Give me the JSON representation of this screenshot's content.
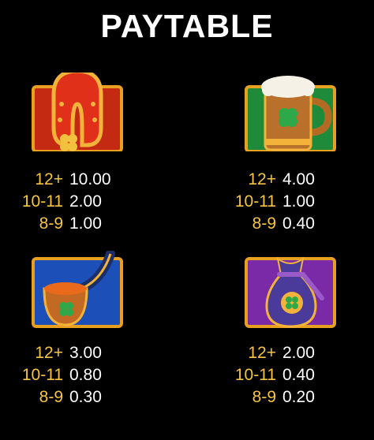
{
  "title": "PAYTABLE",
  "symbols": [
    {
      "icon": "horseshoe-icon",
      "bg": "#c42a12",
      "pays": [
        {
          "count": "12+",
          "value": "10.00"
        },
        {
          "count": "10-11",
          "value": "2.00"
        },
        {
          "count": "8-9",
          "value": "1.00"
        }
      ]
    },
    {
      "icon": "beer-mug-icon",
      "bg": "#1f8a3a",
      "pays": [
        {
          "count": "12+",
          "value": "4.00"
        },
        {
          "count": "10-11",
          "value": "1.00"
        },
        {
          "count": "8-9",
          "value": "0.40"
        }
      ]
    },
    {
      "icon": "pipe-icon",
      "bg": "#1c4fb8",
      "pays": [
        {
          "count": "12+",
          "value": "3.00"
        },
        {
          "count": "10-11",
          "value": "0.80"
        },
        {
          "count": "8-9",
          "value": "0.30"
        }
      ]
    },
    {
      "icon": "money-bag-icon",
      "bg": "#7a2aa6",
      "pays": [
        {
          "count": "12+",
          "value": "2.00"
        },
        {
          "count": "10-11",
          "value": "0.40"
        },
        {
          "count": "8-9",
          "value": "0.20"
        }
      ]
    }
  ]
}
